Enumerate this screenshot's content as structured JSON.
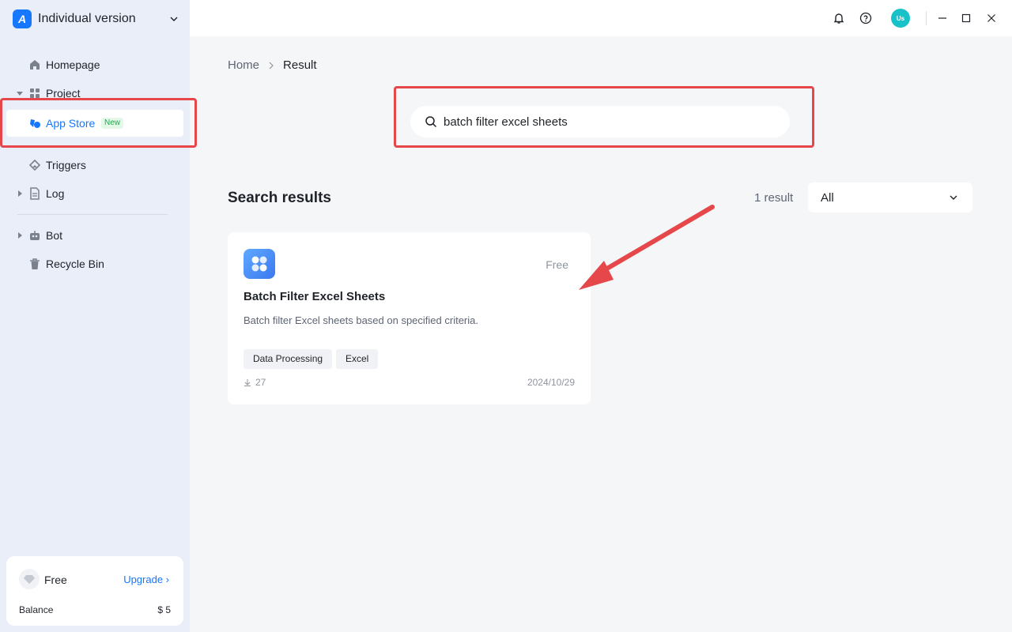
{
  "workspace": {
    "title": "Individual version"
  },
  "sidebar": {
    "items": [
      {
        "label": "Homepage"
      },
      {
        "label": "Project"
      },
      {
        "label": "App Store",
        "badge": "New"
      },
      {
        "label": "Triggers"
      },
      {
        "label": "Log"
      },
      {
        "label": "Bot"
      },
      {
        "label": "Recycle Bin"
      }
    ],
    "plan": {
      "name": "Free",
      "upgrade_label": "Upgrade ›",
      "balance_label": "Balance",
      "balance_value": "$ 5"
    }
  },
  "topbar": {
    "avatar_text": "Us"
  },
  "breadcrumb": {
    "home": "Home",
    "current": "Result"
  },
  "search": {
    "value": "batch filter excel sheets"
  },
  "results": {
    "title": "Search results",
    "count": "1 result",
    "filter_value": "All",
    "items": [
      {
        "title": "Batch Filter Excel Sheets",
        "description": "Batch filter Excel sheets based on specified criteria.",
        "price": "Free",
        "tags": [
          "Data Processing",
          "Excel"
        ],
        "downloads": "27",
        "date": "2024/10/29"
      }
    ]
  },
  "colors": {
    "accent": "#1677ff",
    "highlight": "#e5474b",
    "sidebar_bg": "#e9eef8"
  }
}
